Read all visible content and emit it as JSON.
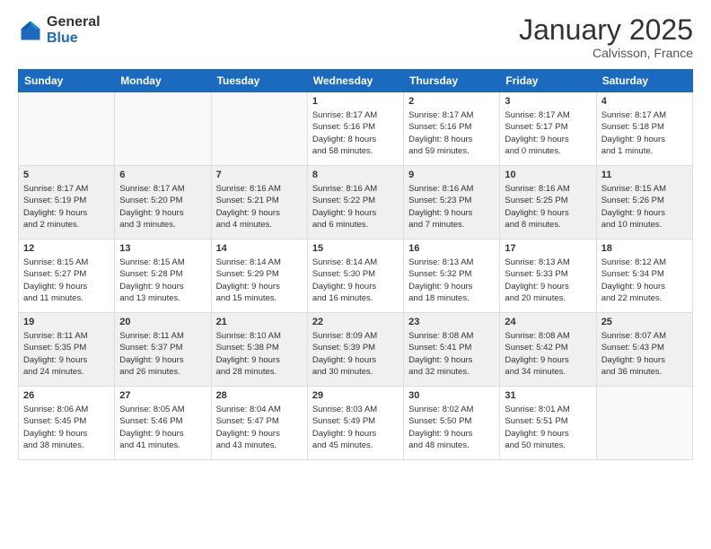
{
  "logo": {
    "general": "General",
    "blue": "Blue"
  },
  "header": {
    "month": "January 2025",
    "location": "Calvisson, France"
  },
  "weekdays": [
    "Sunday",
    "Monday",
    "Tuesday",
    "Wednesday",
    "Thursday",
    "Friday",
    "Saturday"
  ],
  "weeks": [
    [
      {
        "day": "",
        "info": ""
      },
      {
        "day": "",
        "info": ""
      },
      {
        "day": "",
        "info": ""
      },
      {
        "day": "1",
        "info": "Sunrise: 8:17 AM\nSunset: 5:16 PM\nDaylight: 8 hours\nand 58 minutes."
      },
      {
        "day": "2",
        "info": "Sunrise: 8:17 AM\nSunset: 5:16 PM\nDaylight: 8 hours\nand 59 minutes."
      },
      {
        "day": "3",
        "info": "Sunrise: 8:17 AM\nSunset: 5:17 PM\nDaylight: 9 hours\nand 0 minutes."
      },
      {
        "day": "4",
        "info": "Sunrise: 8:17 AM\nSunset: 5:18 PM\nDaylight: 9 hours\nand 1 minute."
      }
    ],
    [
      {
        "day": "5",
        "info": "Sunrise: 8:17 AM\nSunset: 5:19 PM\nDaylight: 9 hours\nand 2 minutes."
      },
      {
        "day": "6",
        "info": "Sunrise: 8:17 AM\nSunset: 5:20 PM\nDaylight: 9 hours\nand 3 minutes."
      },
      {
        "day": "7",
        "info": "Sunrise: 8:16 AM\nSunset: 5:21 PM\nDaylight: 9 hours\nand 4 minutes."
      },
      {
        "day": "8",
        "info": "Sunrise: 8:16 AM\nSunset: 5:22 PM\nDaylight: 9 hours\nand 6 minutes."
      },
      {
        "day": "9",
        "info": "Sunrise: 8:16 AM\nSunset: 5:23 PM\nDaylight: 9 hours\nand 7 minutes."
      },
      {
        "day": "10",
        "info": "Sunrise: 8:16 AM\nSunset: 5:25 PM\nDaylight: 9 hours\nand 8 minutes."
      },
      {
        "day": "11",
        "info": "Sunrise: 8:15 AM\nSunset: 5:26 PM\nDaylight: 9 hours\nand 10 minutes."
      }
    ],
    [
      {
        "day": "12",
        "info": "Sunrise: 8:15 AM\nSunset: 5:27 PM\nDaylight: 9 hours\nand 11 minutes."
      },
      {
        "day": "13",
        "info": "Sunrise: 8:15 AM\nSunset: 5:28 PM\nDaylight: 9 hours\nand 13 minutes."
      },
      {
        "day": "14",
        "info": "Sunrise: 8:14 AM\nSunset: 5:29 PM\nDaylight: 9 hours\nand 15 minutes."
      },
      {
        "day": "15",
        "info": "Sunrise: 8:14 AM\nSunset: 5:30 PM\nDaylight: 9 hours\nand 16 minutes."
      },
      {
        "day": "16",
        "info": "Sunrise: 8:13 AM\nSunset: 5:32 PM\nDaylight: 9 hours\nand 18 minutes."
      },
      {
        "day": "17",
        "info": "Sunrise: 8:13 AM\nSunset: 5:33 PM\nDaylight: 9 hours\nand 20 minutes."
      },
      {
        "day": "18",
        "info": "Sunrise: 8:12 AM\nSunset: 5:34 PM\nDaylight: 9 hours\nand 22 minutes."
      }
    ],
    [
      {
        "day": "19",
        "info": "Sunrise: 8:11 AM\nSunset: 5:35 PM\nDaylight: 9 hours\nand 24 minutes."
      },
      {
        "day": "20",
        "info": "Sunrise: 8:11 AM\nSunset: 5:37 PM\nDaylight: 9 hours\nand 26 minutes."
      },
      {
        "day": "21",
        "info": "Sunrise: 8:10 AM\nSunset: 5:38 PM\nDaylight: 9 hours\nand 28 minutes."
      },
      {
        "day": "22",
        "info": "Sunrise: 8:09 AM\nSunset: 5:39 PM\nDaylight: 9 hours\nand 30 minutes."
      },
      {
        "day": "23",
        "info": "Sunrise: 8:08 AM\nSunset: 5:41 PM\nDaylight: 9 hours\nand 32 minutes."
      },
      {
        "day": "24",
        "info": "Sunrise: 8:08 AM\nSunset: 5:42 PM\nDaylight: 9 hours\nand 34 minutes."
      },
      {
        "day": "25",
        "info": "Sunrise: 8:07 AM\nSunset: 5:43 PM\nDaylight: 9 hours\nand 36 minutes."
      }
    ],
    [
      {
        "day": "26",
        "info": "Sunrise: 8:06 AM\nSunset: 5:45 PM\nDaylight: 9 hours\nand 38 minutes."
      },
      {
        "day": "27",
        "info": "Sunrise: 8:05 AM\nSunset: 5:46 PM\nDaylight: 9 hours\nand 41 minutes."
      },
      {
        "day": "28",
        "info": "Sunrise: 8:04 AM\nSunset: 5:47 PM\nDaylight: 9 hours\nand 43 minutes."
      },
      {
        "day": "29",
        "info": "Sunrise: 8:03 AM\nSunset: 5:49 PM\nDaylight: 9 hours\nand 45 minutes."
      },
      {
        "day": "30",
        "info": "Sunrise: 8:02 AM\nSunset: 5:50 PM\nDaylight: 9 hours\nand 48 minutes."
      },
      {
        "day": "31",
        "info": "Sunrise: 8:01 AM\nSunset: 5:51 PM\nDaylight: 9 hours\nand 50 minutes."
      },
      {
        "day": "",
        "info": ""
      }
    ]
  ]
}
